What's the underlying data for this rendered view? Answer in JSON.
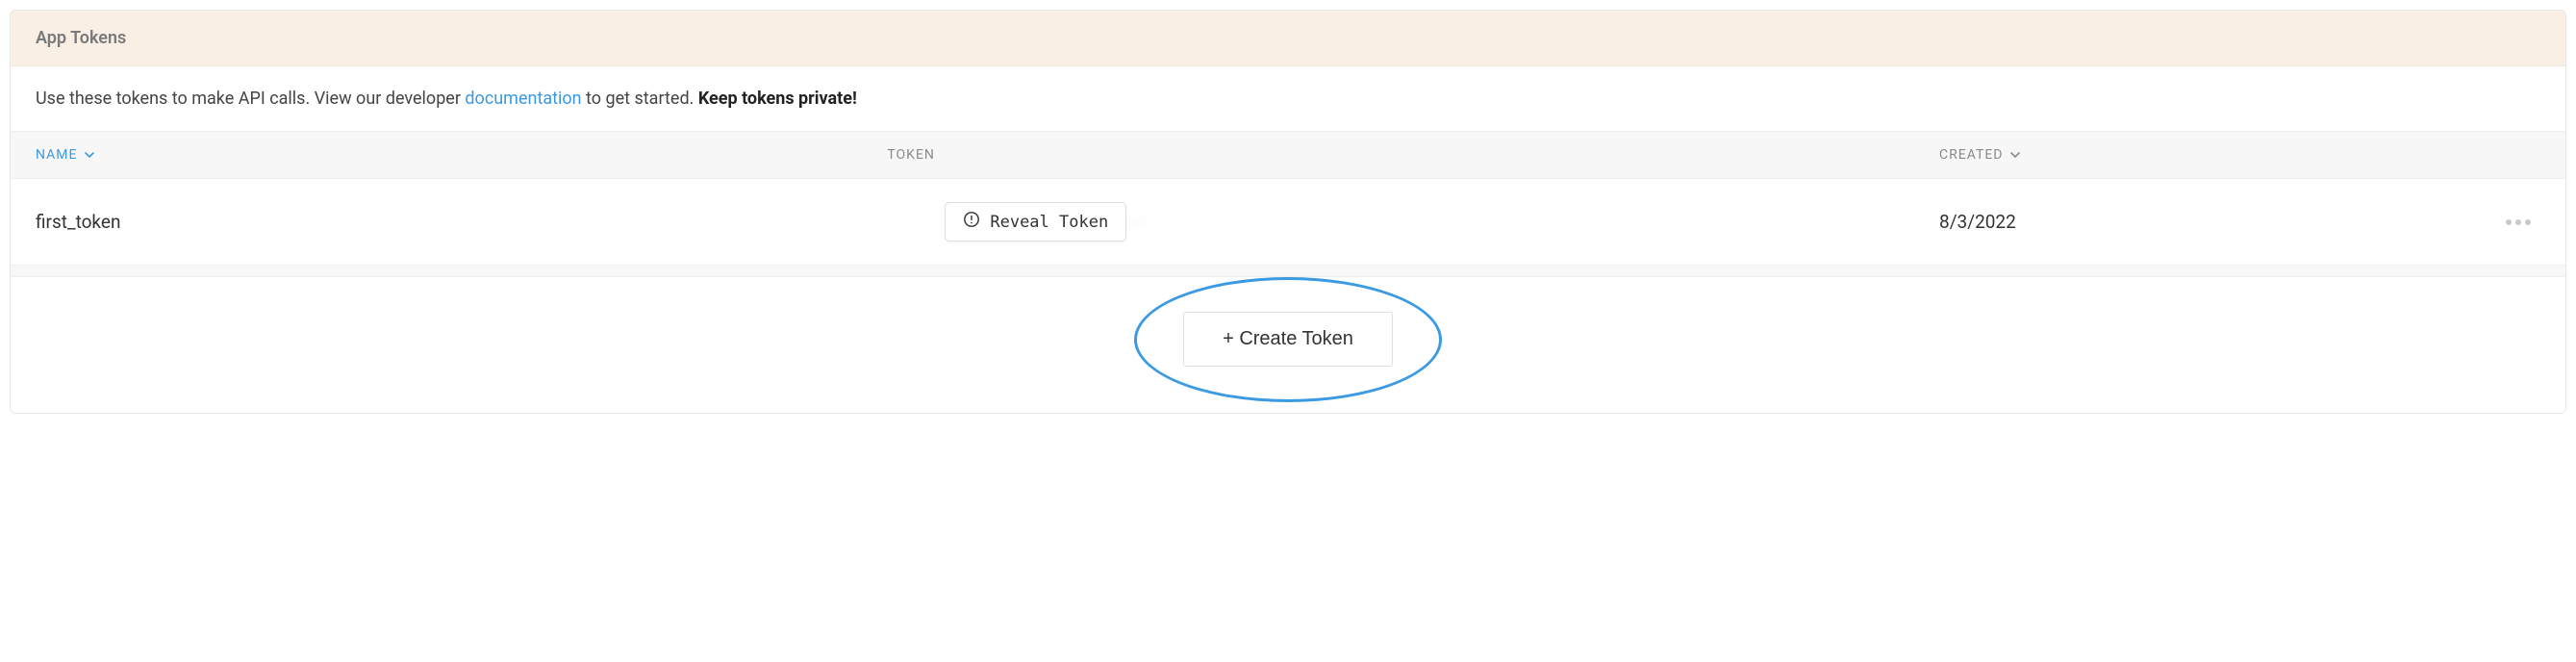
{
  "header": {
    "title": "App Tokens"
  },
  "subtext": {
    "pre": "Use these tokens to make API calls. View our developer ",
    "link": "documentation",
    "post": " to get started. ",
    "strong": "Keep tokens private!"
  },
  "columns": {
    "name": "NAME",
    "token": "TOKEN",
    "created": "CREATED"
  },
  "rows": [
    {
      "name": "first_token",
      "reveal_label": "Reveal Token",
      "created": "8/3/2022"
    }
  ],
  "create": {
    "label": "+ Create Token"
  }
}
